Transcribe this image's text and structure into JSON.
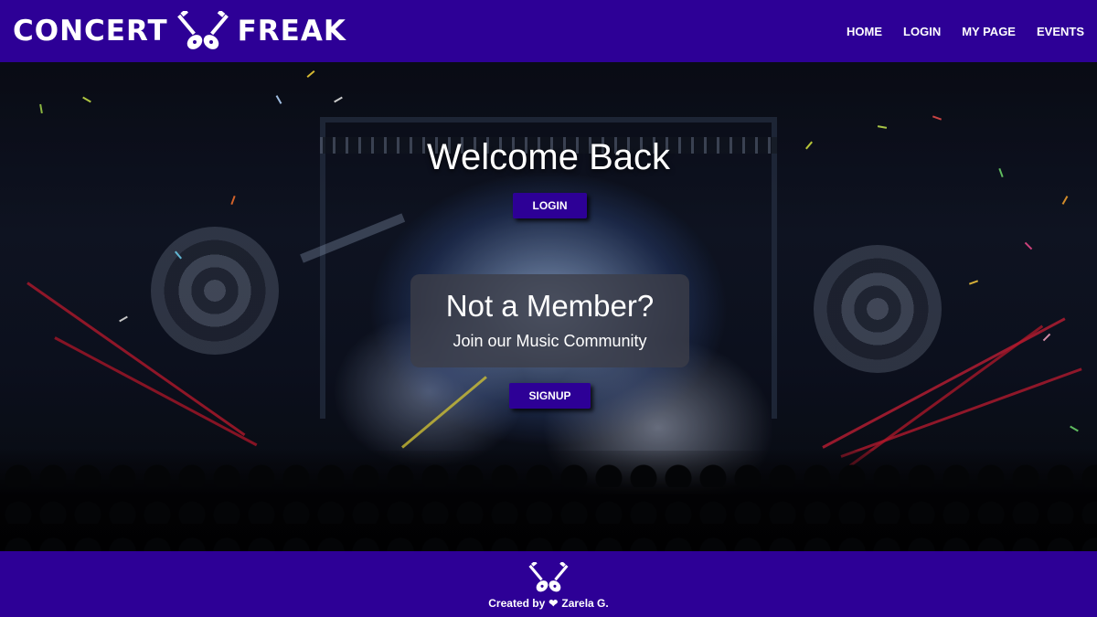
{
  "brand": {
    "word_left": "CONCERT",
    "word_right": "FREAK",
    "logo_icon": "crossed-guitars-icon"
  },
  "nav": {
    "items": [
      {
        "label": "HOME"
      },
      {
        "label": "LOGIN"
      },
      {
        "label": "MY PAGE"
      },
      {
        "label": "EVENTS"
      }
    ]
  },
  "hero": {
    "title": "Welcome Back",
    "login_button": "LOGIN",
    "member_box": {
      "title": "Not a Member?",
      "subtitle": "Join our Music Community"
    },
    "signup_button": "SIGNUP"
  },
  "footer": {
    "icon": "crossed-guitars-icon",
    "prefix": "Created by",
    "heart_icon": "heart-icon",
    "author": "Zarela G."
  },
  "colors": {
    "brand": "#2d0096",
    "text": "#ffffff"
  }
}
